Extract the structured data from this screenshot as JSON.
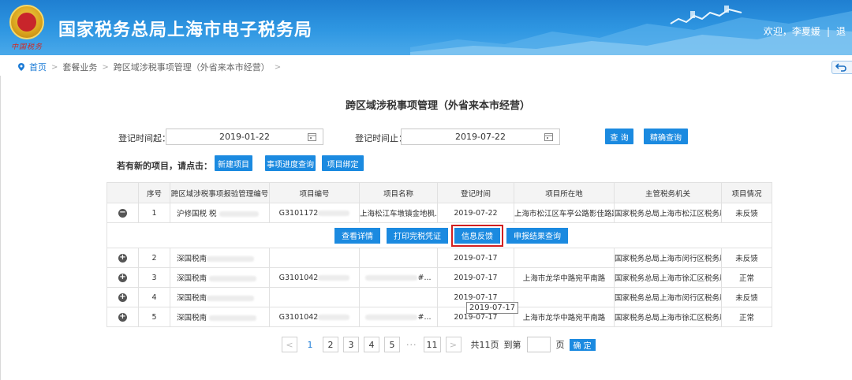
{
  "header": {
    "site_title": "国家税务总局上海市电子税务局",
    "emblem_caption": "中国税务",
    "welcome": "欢迎，李夏媛",
    "separator": "|",
    "trailing": "退"
  },
  "breadcrumb": {
    "home": "首页",
    "level1": "套餐业务",
    "level2": "跨区域涉税事项管理（外省来本市经营）",
    "sep": ">",
    "back_label": "返回"
  },
  "page_title": "跨区域涉税事项管理（外省来本市经营）",
  "filters": {
    "start_label": "登记时间起：",
    "start_value": "2019-01-22",
    "end_label": "登记时间止：",
    "end_value": "2019-07-22",
    "query_btn": "查 询",
    "exact_query_btn": "精确查询"
  },
  "new_items": {
    "prompt": "若有新的项目，请点击：",
    "new_project": "新建项目",
    "progress_query": "事项进度查询",
    "bind_project": "项目绑定"
  },
  "table": {
    "headers": [
      "",
      "序号",
      "跨区域涉税事项报验管理编号",
      "项目编号",
      "项目名称",
      "登记时间",
      "项目所在地",
      "主管税务机关",
      "项目情况"
    ],
    "rows": [
      {
        "toggle": "−",
        "seq": "1",
        "mgmt_no": "沪修国税 税",
        "proj_no": "G3101172",
        "proj_name": "上海松江车墩镇金地枫...",
        "reg_time": "2019-07-22",
        "location": "上海市松江区车亭公路影佳路路...",
        "authority": "国家税务总局上海市松江区税务局",
        "status": "未反馈"
      },
      {
        "toggle": "+",
        "seq": "2",
        "mgmt_no": "深国税南",
        "proj_no": "",
        "proj_name": "",
        "reg_time": "2019-07-17",
        "location": "",
        "authority": "国家税务总局上海市闵行区税务局",
        "status": "未反馈"
      },
      {
        "toggle": "+",
        "seq": "3",
        "mgmt_no": "深国税南",
        "proj_no": "G3101042",
        "proj_name": "#...",
        "reg_time": "2019-07-17",
        "location": "上海市龙华中路宛平南路",
        "authority": "国家税务总局上海市徐汇区税务局",
        "status": "正常"
      },
      {
        "toggle": "+",
        "seq": "4",
        "mgmt_no": "深国税南",
        "proj_no": "",
        "proj_name": "",
        "reg_time": "2019-07-17",
        "location": "",
        "authority": "国家税务总局上海市闵行区税务局",
        "status": "未反馈"
      },
      {
        "toggle": "+",
        "seq": "5",
        "mgmt_no": "深国税南",
        "proj_no": "G3101042",
        "proj_name": "#...",
        "reg_time": "2019-07-17",
        "location": "上海市龙华中路宛平南路",
        "authority": "国家税务总局上海市徐汇区税务局",
        "status": "正常"
      }
    ],
    "actions": {
      "view_detail": "查看详情",
      "print_cert": "打印完税凭证",
      "info_feedback": "信息反馈",
      "report_query": "申报结果查询"
    },
    "tooltip": "2019-07-17"
  },
  "pager": {
    "prev": "<",
    "pages": [
      "1",
      "2",
      "3",
      "4",
      "5"
    ],
    "ellipsis": "···",
    "last": "11",
    "next": ">",
    "total": "共11页",
    "goto_label": "到第",
    "page_unit": "页",
    "confirm": "确 定"
  }
}
